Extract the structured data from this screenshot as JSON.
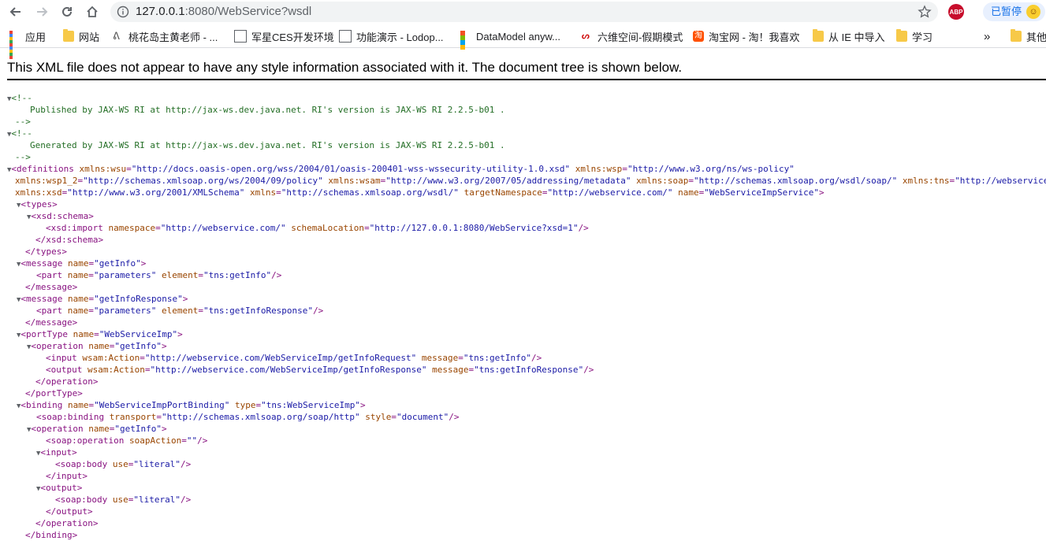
{
  "browser": {
    "url_host": "127.0.0.1",
    "url_rest": ":8080/WebService?wsdl",
    "pause_label": "已暂停",
    "abp_label": "ABP"
  },
  "bookmarks": [
    {
      "label": "应用",
      "icon": "apps-grid-icon"
    },
    {
      "label": "网站",
      "icon": "folder-icon"
    },
    {
      "label": "桃花岛主黄老师 - ...",
      "icon": "site-icon"
    },
    {
      "label": "军星CES开发环境",
      "icon": "document-icon"
    },
    {
      "label": "功能演示 - Lodop...",
      "icon": "document-icon"
    },
    {
      "label": "DataModel anyw...",
      "icon": "windows-icon"
    },
    {
      "label": "六维空间-假期模式",
      "icon": "site-icon"
    },
    {
      "label": "淘宝网 - 淘！我喜欢",
      "icon": "taobao-icon"
    },
    {
      "label": "从 IE 中导入",
      "icon": "folder-icon"
    },
    {
      "label": "学习",
      "icon": "folder-icon"
    },
    {
      "label": "»",
      "icon": "overflow-chevron-icon"
    },
    {
      "label": "其他",
      "icon": "folder-icon"
    }
  ],
  "message": "This XML file does not appear to have any style information associated with it. The document tree is shown below.",
  "xml": {
    "c1_open": "<!--",
    "c1_text": "Published by JAX-WS RI at http://jax-ws.dev.java.net. RI's version is JAX-WS RI 2.2.5-b01 .",
    "c1_close": "-->",
    "c2_open": "<!--",
    "c2_text": "Generated by JAX-WS RI at http://jax-ws.dev.java.net. RI's version is JAX-WS RI 2.2.5-b01 .",
    "c2_close": "-->",
    "defs_tag": "<definitions",
    "xmlns_wsu_n": "xmlns:wsu",
    "xmlns_wsu_v": "http://docs.oasis-open.org/wss/2004/01/oasis-200401-wss-wssecurity-utility-1.0.xsd",
    "xmlns_wsp_n": "xmlns:wsp",
    "xmlns_wsp_v": "http://www.w3.org/ns/ws-policy",
    "xmlns_wsp12_n": "xmlns:wsp1_2",
    "xmlns_wsp12_v": "http://schemas.xmlsoap.org/ws/2004/09/policy",
    "xmlns_wsam_n": "xmlns:wsam",
    "xmlns_wsam_v": "http://www.w3.org/2007/05/addressing/metadata",
    "xmlns_soap_n": "xmlns:soap",
    "xmlns_soap_v": "http://schemas.xmlsoap.org/wsdl/soap/",
    "xmlns_tns_n": "xmlns:tns",
    "xmlns_tns_v": "http://webservice.co",
    "xmlns_xsd_n": "xmlns:xsd",
    "xmlns_xsd_v": "http://www.w3.org/2001/XMLSchema",
    "xmlns_n": "xmlns",
    "xmlns_v": "http://schemas.xmlsoap.org/wsdl/",
    "tns_n": "targetNamespace",
    "tns_v": "http://webservice.com/",
    "name_n": "name",
    "defs_name_v": "WebServiceImpService",
    "types_open": "<types>",
    "xsd_schema_open": "<xsd:schema>",
    "xsd_import_tag": "<xsd:import",
    "namespace_n": "namespace",
    "namespace_v": "http://webservice.com/",
    "schemaloc_n": "schemaLocation",
    "schemaloc_v": "http://127.0.0.1:8080/WebService?xsd=1",
    "xsd_schema_close": "</xsd:schema>",
    "types_close": "</types>",
    "message_tag": "<message",
    "msg1_name_v": "getInfo",
    "part_tag": "<part",
    "part_name_v": "parameters",
    "element_n": "element",
    "part1_element_v": "tns:getInfo",
    "message_close": "</message>",
    "msg2_name_v": "getInfoResponse",
    "part2_element_v": "tns:getInfoResponse",
    "porttype_tag": "<portType",
    "porttype_name_v": "WebServiceImp",
    "operation_tag": "<operation",
    "op_name_v": "getInfo",
    "input_tag": "<input",
    "wsam_action_n": "wsam:Action",
    "input_action_v": "http://webservice.com/WebServiceImp/getInfoRequest",
    "message_n": "message",
    "input_message_v": "tns:getInfo",
    "output_tag": "<output",
    "output_action_v": "http://webservice.com/WebServiceImp/getInfoResponse",
    "output_message_v": "tns:getInfoResponse",
    "operation_close": "</operation>",
    "porttype_close": "</portType>",
    "binding_tag": "<binding",
    "binding_name_v": "WebServiceImpPortBinding",
    "type_n": "type",
    "binding_type_v": "tns:WebServiceImp",
    "soap_binding_tag": "<soap:binding",
    "transport_n": "transport",
    "transport_v": "http://schemas.xmlsoap.org/soap/http",
    "style_n": "style",
    "style_v": "document",
    "soap_operation_tag": "<soap:operation",
    "soapaction_n": "soapAction",
    "soapaction_v": "",
    "input_open": "<input>",
    "soap_body_tag": "<soap:body",
    "use_n": "use",
    "use_v": "literal",
    "input_close": "</input>",
    "output_open": "<output>",
    "output_close": "</output>",
    "binding_close": "</binding>",
    "gt": ">",
    "selfclose": "/>",
    "eq": "=",
    "quot": "\""
  }
}
